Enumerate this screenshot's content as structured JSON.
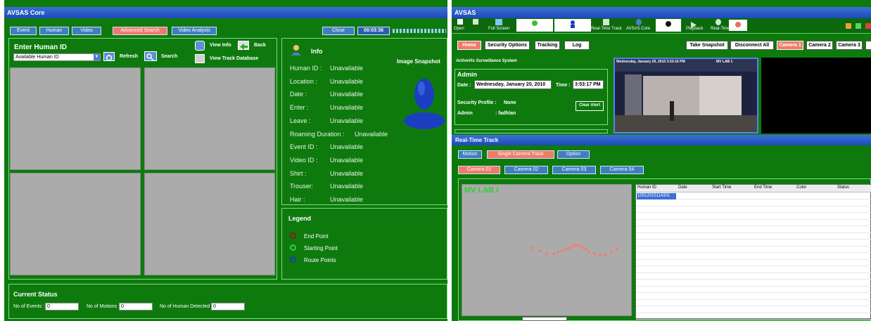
{
  "left_app": {
    "title": "AVSAS Core",
    "toolbar": {
      "event": "Event",
      "human": "Human",
      "video": "Video",
      "advanced_search": "Advanced Search",
      "video_analysis": "Video Analysis",
      "close": "Close",
      "timer": "00:03:36"
    },
    "search": {
      "heading": "Enter Human ID",
      "select_value": "Available Human ID",
      "refresh": "Refresh",
      "search": "Search",
      "view_info": "View Info",
      "back": "Back",
      "view_track_db": "View Track Database"
    },
    "info": {
      "heading": "Info",
      "snapshot_label": "Image Snapshot",
      "fields": [
        {
          "label": "Human ID :",
          "value": "Unavailable"
        },
        {
          "label": "Location :",
          "value": "Unavailable"
        },
        {
          "label": "Date :",
          "value": "Unavailable"
        },
        {
          "label": "Enter :",
          "value": "Unavailable"
        },
        {
          "label": "Leave :",
          "value": "Unavailable"
        },
        {
          "label": "Roaming Duration :",
          "value": "Unavailable"
        },
        {
          "label": "Event ID :",
          "value": "Unavailable"
        },
        {
          "label": "Video ID :",
          "value": "Unavailable"
        },
        {
          "label": "Shirt :",
          "value": "Unavailable"
        },
        {
          "label": "Trouser:",
          "value": "Unavailable"
        },
        {
          "label": "Hair :",
          "value": "Unavailable"
        }
      ]
    },
    "legend": {
      "heading": "Legend",
      "items": [
        {
          "label": "End Point",
          "color": "#8b1a1a"
        },
        {
          "label": "Starting Point",
          "color": "#39d039"
        },
        {
          "label": "Route Points",
          "color": "#1a3fb5"
        }
      ]
    },
    "status": {
      "heading": "Current Status",
      "events_label": "No of Events :",
      "events_value": "0",
      "motions_label": "No of Motions :",
      "motions_value": "0",
      "humans_label": "No of Human Detected :",
      "humans_value": "0"
    }
  },
  "right_app": {
    "title": "AVSAS",
    "toolbar": {
      "open": "Open",
      "full_screen": "Full Screen",
      "real_time_track": "Real-Time Track",
      "avsas_core": "AVSAS Core",
      "playback": "Playback",
      "real_time": "Real-Time"
    },
    "nav": {
      "home": "Home",
      "security_options": "Security Options",
      "tracking": "Tracking",
      "log": "Log",
      "take_snapshot": "Take Snapshot",
      "disconnect_all": "Disconnect All",
      "camera1": "Camera 1",
      "camera2": "Camera 2",
      "camera3": "Camera 3"
    },
    "system_name": "ActiveVis Surveillance System",
    "admin": {
      "heading": "Admin",
      "date_label": "Date :",
      "date_value": "Wednesday, January 20, 2010",
      "time_label": "Time :",
      "time_value": "3:53:17 PM",
      "profile_label": "Security Profile :",
      "profile_value": "None",
      "user_label": "Admin",
      "user_value": ": fadhlan",
      "clear_alert": "Clear Alert"
    },
    "camera_overlay": {
      "timestamp": "Wednesday, January 20, 2010 3:53:16 PM",
      "lab": "MV LAB 1"
    },
    "realtime": {
      "title": "Real-Time Track",
      "motion": "Motion",
      "single_camera_track": "Single Camera Track",
      "option": "Option",
      "cam_tabs": [
        "Camera 01",
        "Camera 02",
        "Camera 03",
        "Camera 04"
      ],
      "track_label": "MV LAB I",
      "columns": [
        "Human ID",
        "Date",
        "Start Time",
        "End Time",
        "Color",
        "Status"
      ],
      "rows": [
        [
          "10012015114301",
          "",
          "",
          "",
          "",
          ""
        ]
      ]
    }
  }
}
